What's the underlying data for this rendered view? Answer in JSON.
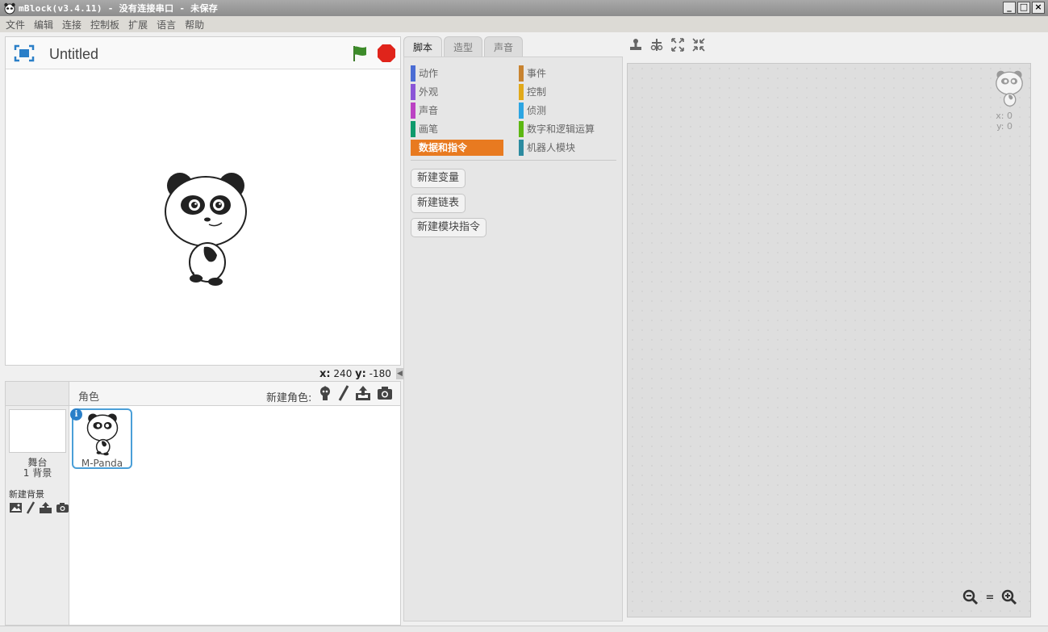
{
  "window": {
    "title": "mBlock(v3.4.11) - 没有连接串口 - 未保存",
    "minimize": "_",
    "maximize": "□",
    "close": "×"
  },
  "menu": [
    "文件",
    "编辑",
    "连接",
    "控制板",
    "扩展",
    "语言",
    "帮助"
  ],
  "stage": {
    "project_title": "Untitled",
    "coords": {
      "x_label": "x:",
      "x": "240",
      "y_label": "y:",
      "y": "-180"
    }
  },
  "sprites_panel": {
    "stage_label": "舞台",
    "backdrop_count": "1 背景",
    "new_backdrop_label": "新建背景",
    "sprites_label": "角色",
    "new_sprite_label": "新建角色:",
    "sprite": {
      "name": "M-Panda",
      "info": "i"
    }
  },
  "tabs": [
    "脚本",
    "造型",
    "声音"
  ],
  "categories": [
    {
      "label": "动作",
      "color": "#4a6cd4"
    },
    {
      "label": "事件",
      "color": "#c88330"
    },
    {
      "label": "外观",
      "color": "#8a55d7"
    },
    {
      "label": "控制",
      "color": "#e1a91a"
    },
    {
      "label": "声音",
      "color": "#bb42c3"
    },
    {
      "label": "侦测",
      "color": "#2ca5e2"
    },
    {
      "label": "画笔",
      "color": "#0e9a6c"
    },
    {
      "label": "数字和逻辑运算",
      "color": "#5cb712"
    },
    {
      "label": "数据和指令",
      "color": "#ee7d16"
    },
    {
      "label": "机器人模块",
      "color": "#2c8ba0"
    }
  ],
  "palette_buttons": [
    "新建变量",
    "新建链表",
    "新建模块指令"
  ],
  "scripts": {
    "sprite_x": "x: 0",
    "sprite_y": "y: 0",
    "zoom_reset": "="
  }
}
